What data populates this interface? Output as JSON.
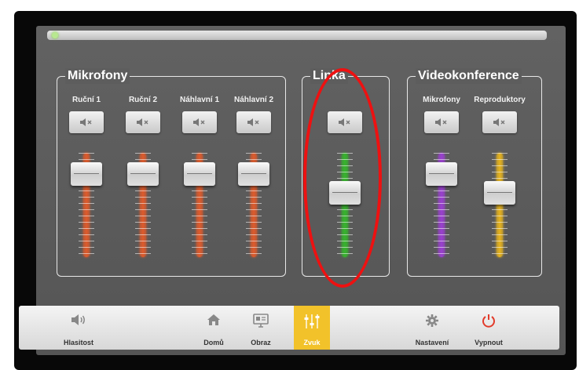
{
  "groups": {
    "mikrofony": {
      "title": "Mikrofony",
      "channels": [
        {
          "label": "Ruční 1",
          "level": 0.88
        },
        {
          "label": "Ruční 2",
          "level": 0.88
        },
        {
          "label": "Náhlavní 1",
          "level": 0.88
        },
        {
          "label": "Náhlavní 2",
          "level": 0.88
        }
      ]
    },
    "linka": {
      "title": "Linka",
      "channels": [
        {
          "label": "",
          "level": 0.65
        }
      ]
    },
    "videokonference": {
      "title": "Videokonference",
      "channels": [
        {
          "label": "Mikrofony",
          "level": 0.88
        },
        {
          "label": "Reproduktory",
          "level": 0.65
        }
      ]
    }
  },
  "nav": [
    {
      "label": "Hlasitost",
      "icon": "speaker-icon"
    },
    {
      "label": "Domů",
      "icon": "home-icon"
    },
    {
      "label": "Obraz",
      "icon": "monitor-icon"
    },
    {
      "label": "Zvuk",
      "icon": "sliders-icon",
      "active": true
    },
    {
      "label": "Nastavení",
      "icon": "gear-icon"
    },
    {
      "label": "Vypnout",
      "icon": "power-icon"
    }
  ],
  "colors": {
    "mic": "#e05a2a",
    "line": "#35b52b",
    "vc_mic": "#9b3fd1",
    "vc_rep": "#e7b31c",
    "active_tab": "#f2c22a",
    "power": "#e23b2b",
    "annotation": "#ee1111"
  }
}
